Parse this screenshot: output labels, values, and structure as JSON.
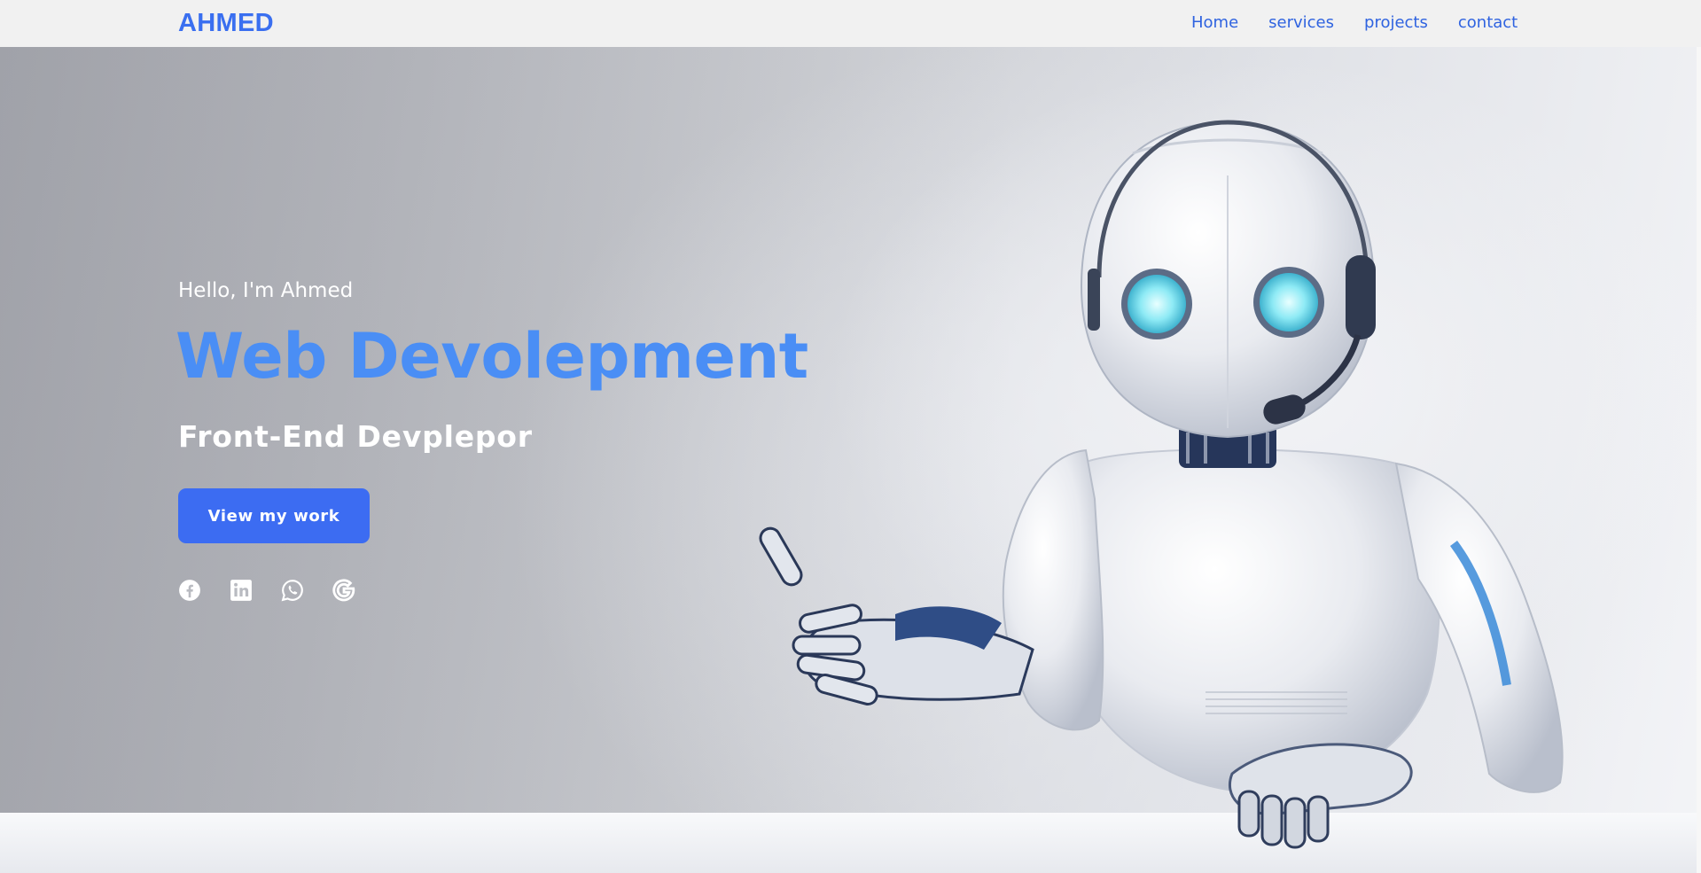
{
  "header": {
    "logo": "AHMED",
    "nav": [
      "Home",
      "services",
      "projects",
      "contact"
    ]
  },
  "hero": {
    "greeting": "Hello, I'm Ahmed",
    "title": "Web Devolepment",
    "subtitle": "Front-End Devplepor",
    "cta_label": "View my work",
    "socials": [
      "facebook-icon",
      "linkedin-icon",
      "whatsapp-icon",
      "google-icon"
    ]
  },
  "colors": {
    "brand": "#3a6ff0",
    "title": "#4a8ef5",
    "button": "#3c6cf2",
    "header_bg": "#f1f1f1"
  }
}
